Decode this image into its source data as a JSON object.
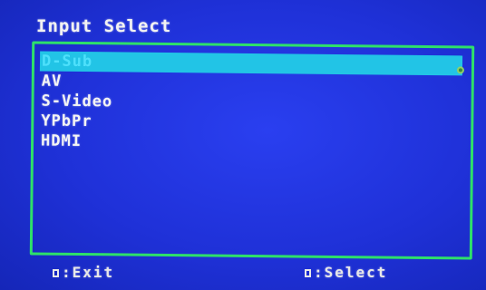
{
  "header": {
    "title": "Input Select"
  },
  "menu": {
    "items": [
      {
        "label": "D-Sub",
        "selected": true
      },
      {
        "label": "AV",
        "selected": false
      },
      {
        "label": "S-Video",
        "selected": false
      },
      {
        "label": "YPbPr",
        "selected": false
      },
      {
        "label": "HDMI",
        "selected": false
      }
    ]
  },
  "footer": {
    "exit_label": ":Exit",
    "select_label": ":Select",
    "exit_icon": "menu-key-icon",
    "select_icon": "source-key-icon"
  },
  "colors": {
    "background": "#1f2fd6",
    "frame": "#2ee06a",
    "highlight": "#22c4e6",
    "text": "#f4f4f4"
  }
}
